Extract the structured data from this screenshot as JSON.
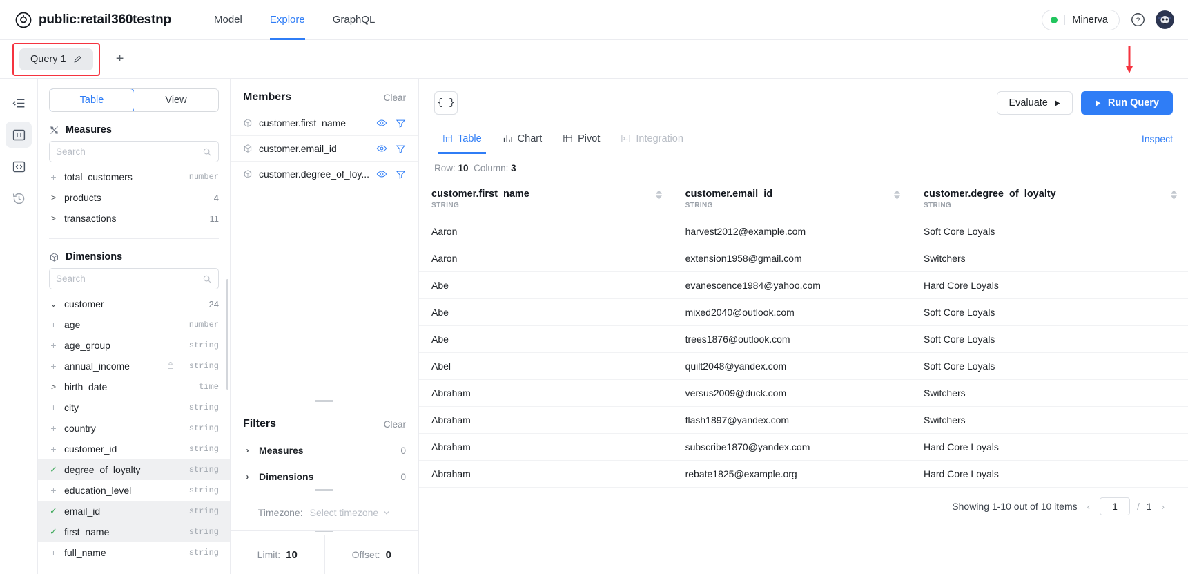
{
  "header": {
    "brand_title": "public:retail360testnp",
    "nav_tabs": [
      {
        "label": "Model",
        "active": false
      },
      {
        "label": "Explore",
        "active": true
      },
      {
        "label": "GraphQL",
        "active": false
      }
    ],
    "status_name": "Minerva",
    "status_color": "#22c55e",
    "help_icon": "question-circle-icon",
    "avatar_icon": "user-avatar"
  },
  "query_tabs": {
    "tab_label": "Query 1",
    "edit_icon": "pencil-icon",
    "add_label": "+",
    "highlight_color": "#f5333f"
  },
  "rail": {
    "items": [
      {
        "icon": "panel-collapse-icon",
        "active": false
      },
      {
        "icon": "columns-icon",
        "active": true
      },
      {
        "icon": "code-icon",
        "active": false
      },
      {
        "icon": "history-icon",
        "active": false
      }
    ]
  },
  "left_panel": {
    "segments": [
      {
        "label": "Table",
        "active": true
      },
      {
        "label": "View",
        "active": false
      }
    ],
    "measures": {
      "title": "Measures",
      "icon": "measures-icon",
      "search_placeholder": "Search",
      "search_value": "",
      "items": [
        {
          "marker": "+",
          "name": "total_customers",
          "type": "number",
          "count": "",
          "selected": false
        },
        {
          "marker": ">",
          "name": "products",
          "type": "",
          "count": "4",
          "selected": false
        },
        {
          "marker": ">",
          "name": "transactions",
          "type": "",
          "count": "11",
          "selected": false
        }
      ]
    },
    "dimensions": {
      "title": "Dimensions",
      "icon": "cube-icon",
      "search_placeholder": "Search",
      "search_value": "",
      "items": [
        {
          "marker": "v",
          "name": "customer",
          "type": "",
          "count": "24",
          "selected": false
        },
        {
          "marker": "+",
          "name": "age",
          "type": "number",
          "count": "",
          "selected": false
        },
        {
          "marker": "+",
          "name": "age_group",
          "type": "string",
          "count": "",
          "selected": false
        },
        {
          "marker": "+",
          "name": "annual_income",
          "type": "string",
          "count": "",
          "selected": false,
          "badge": "lock-icon"
        },
        {
          "marker": ">",
          "name": "birth_date",
          "type": "time",
          "count": "",
          "selected": false
        },
        {
          "marker": "+",
          "name": "city",
          "type": "string",
          "count": "",
          "selected": false
        },
        {
          "marker": "+",
          "name": "country",
          "type": "string",
          "count": "",
          "selected": false
        },
        {
          "marker": "+",
          "name": "customer_id",
          "type": "string",
          "count": "",
          "selected": false
        },
        {
          "marker": "check",
          "name": "degree_of_loyalty",
          "type": "string",
          "count": "",
          "selected": true
        },
        {
          "marker": "+",
          "name": "education_level",
          "type": "string",
          "count": "",
          "selected": false
        },
        {
          "marker": "check",
          "name": "email_id",
          "type": "string",
          "count": "",
          "selected": true
        },
        {
          "marker": "check",
          "name": "first_name",
          "type": "string",
          "count": "",
          "selected": true
        },
        {
          "marker": "+",
          "name": "full_name",
          "type": "string",
          "count": "",
          "selected": false
        }
      ]
    }
  },
  "middle_panel": {
    "members": {
      "title": "Members",
      "clear_label": "Clear",
      "items": [
        {
          "name": "customer.first_name",
          "icon": "cube-icon",
          "eye_icon": "eye-icon",
          "filter_icon": "filter-icon"
        },
        {
          "name": "customer.email_id",
          "icon": "cube-icon",
          "eye_icon": "eye-icon",
          "filter_icon": "filter-icon"
        },
        {
          "name": "customer.degree_of_loy...",
          "icon": "cube-icon",
          "eye_icon": "eye-icon",
          "filter_icon": "filter-icon"
        }
      ]
    },
    "filters": {
      "title": "Filters",
      "clear_label": "Clear",
      "rows": [
        {
          "label": "Measures",
          "count": "0"
        },
        {
          "label": "Dimensions",
          "count": "0"
        }
      ]
    },
    "timezone": {
      "label": "Timezone:",
      "placeholder": "Select timezone",
      "value": ""
    },
    "limit": {
      "label": "Limit:",
      "value": "10"
    },
    "offset": {
      "label": "Offset:",
      "value": "0"
    }
  },
  "main": {
    "json_button": "{ }",
    "evaluate_label": "Evaluate",
    "run_query_label": "Run Query",
    "view_tabs": [
      {
        "label": "Table",
        "icon": "table-icon",
        "active": true,
        "disabled": false
      },
      {
        "label": "Chart",
        "icon": "chart-icon",
        "active": false,
        "disabled": false
      },
      {
        "label": "Pivot",
        "icon": "pivot-icon",
        "active": false,
        "disabled": false
      },
      {
        "label": "Integration",
        "icon": "terminal-icon",
        "active": false,
        "disabled": true
      }
    ],
    "inspect_label": "Inspect",
    "row_label": "Row:",
    "row_value": "10",
    "column_label": "Column:",
    "column_value": "3",
    "table": {
      "columns": [
        {
          "name": "customer.first_name",
          "type": "STRING"
        },
        {
          "name": "customer.email_id",
          "type": "STRING"
        },
        {
          "name": "customer.degree_of_loyalty",
          "type": "STRING"
        }
      ],
      "rows": [
        [
          "Aaron",
          "harvest2012@example.com",
          "Soft Core Loyals"
        ],
        [
          "Aaron",
          "extension1958@gmail.com",
          "Switchers"
        ],
        [
          "Abe",
          "evanescence1984@yahoo.com",
          "Hard Core Loyals"
        ],
        [
          "Abe",
          "mixed2040@outlook.com",
          "Soft Core Loyals"
        ],
        [
          "Abe",
          "trees1876@outlook.com",
          "Soft Core Loyals"
        ],
        [
          "Abel",
          "quilt2048@yandex.com",
          "Soft Core Loyals"
        ],
        [
          "Abraham",
          "versus2009@duck.com",
          "Switchers"
        ],
        [
          "Abraham",
          "flash1897@yandex.com",
          "Switchers"
        ],
        [
          "Abraham",
          "subscribe1870@yandex.com",
          "Hard Core Loyals"
        ],
        [
          "Abraham",
          "rebate1825@example.org",
          "Hard Core Loyals"
        ]
      ]
    },
    "pagination": {
      "showing_label": "Showing 1-10 out of 10 items",
      "prev_icon": "chevron-left-icon",
      "next_icon": "chevron-right-icon",
      "page_value": "1",
      "separator": "/",
      "total_pages": "1"
    }
  }
}
